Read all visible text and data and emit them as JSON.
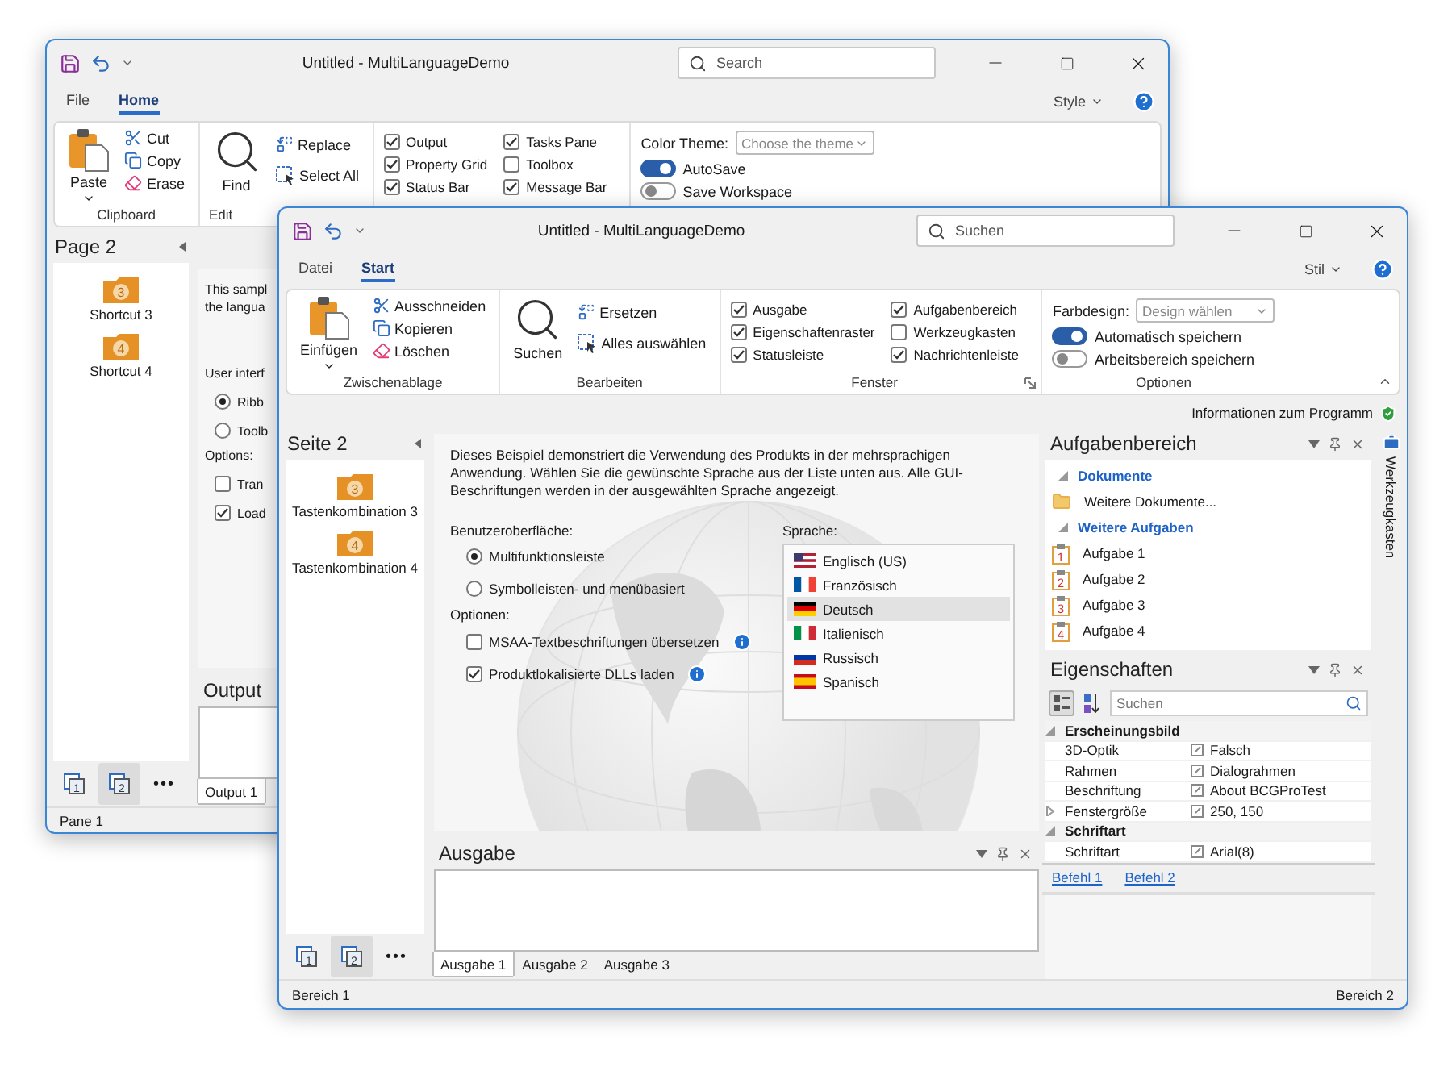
{
  "back_window": {
    "title": "Untitled - MultiLanguageDemo",
    "search": {
      "placeholder": "Search"
    },
    "tabs": [
      {
        "label": "File",
        "selected": false
      },
      {
        "label": "Home",
        "selected": true
      }
    ],
    "style_menu": "Style",
    "ribbon": {
      "clipboard": {
        "paste": "Paste",
        "cut": "Cut",
        "copy": "Copy",
        "erase": "Erase",
        "label": "Clipboard"
      },
      "edit": {
        "find": "Find",
        "replace": "Replace",
        "select_all": "Select All",
        "label": "Edit"
      },
      "view": {
        "checks": [
          {
            "label": "Output",
            "checked": true
          },
          {
            "label": "Property Grid",
            "checked": true
          },
          {
            "label": "Status Bar",
            "checked": true
          },
          {
            "label": "Tasks Pane",
            "checked": true
          },
          {
            "label": "Toolbox",
            "checked": false
          },
          {
            "label": "Message Bar",
            "checked": true
          }
        ]
      },
      "options": {
        "theme_label": "Color Theme:",
        "theme_placeholder": "Choose the theme",
        "toggles": [
          {
            "label": "AutoSave",
            "on": true
          },
          {
            "label": "Save Workspace",
            "on": false
          }
        ]
      }
    },
    "pane": {
      "title": "Page 2",
      "shortcuts": [
        {
          "number": "3",
          "label": "Shortcut 3"
        },
        {
          "number": "4",
          "label": "Shortcut 4"
        }
      ],
      "nav_buttons": [
        {
          "number": "1",
          "selected": false
        },
        {
          "number": "2",
          "selected": true
        }
      ],
      "more": "•••"
    },
    "content": {
      "description": [
        "This sampl",
        "the langua"
      ],
      "ui_label": "User interf",
      "radios": [
        {
          "label": "Ribb",
          "selected": true
        },
        {
          "label": "Toolb",
          "selected": false
        }
      ],
      "options_label": "Options:",
      "checks": [
        {
          "label": "Tran",
          "checked": false
        },
        {
          "label": "Load",
          "checked": true
        }
      ]
    },
    "output": {
      "title": "Output",
      "tabs": [
        {
          "label": "Output 1",
          "selected": true
        }
      ]
    },
    "status": "Pane 1"
  },
  "front_window": {
    "title": "Untitled - MultiLanguageDemo",
    "search": {
      "placeholder": "Suchen"
    },
    "tabs": [
      {
        "label": "Datei",
        "selected": false
      },
      {
        "label": "Start",
        "selected": true
      }
    ],
    "style_menu": "Stil",
    "ribbon": {
      "clipboard": {
        "paste": "Einfügen",
        "cut": "Ausschneiden",
        "copy": "Kopieren",
        "erase": "Löschen",
        "label": "Zwischenablage"
      },
      "edit": {
        "find": "Suchen",
        "replace": "Ersetzen",
        "select_all": "Alles auswählen",
        "label": "Bearbeiten"
      },
      "view": {
        "label": "Fenster",
        "checks": [
          {
            "label": "Ausgabe",
            "checked": true
          },
          {
            "label": "Eigenschaftenraster",
            "checked": true
          },
          {
            "label": "Statusleiste",
            "checked": true
          },
          {
            "label": "Aufgabenbereich",
            "checked": true
          },
          {
            "label": "Werkzeugkasten",
            "checked": false
          },
          {
            "label": "Nachrichtenleiste",
            "checked": true
          }
        ]
      },
      "options": {
        "label": "Optionen",
        "theme_label": "Farbdesign:",
        "theme_placeholder": "Design wählen",
        "toggles": [
          {
            "label": "Automatisch speichern",
            "on": true
          },
          {
            "label": "Arbeitsbereich speichern",
            "on": false
          }
        ]
      }
    },
    "info_link": "Informationen zum Programm",
    "pane": {
      "title": "Seite 2",
      "shortcuts": [
        {
          "number": "3",
          "label": "Tastenkombination 3"
        },
        {
          "number": "4",
          "label": "Tastenkombination 4"
        }
      ],
      "nav_buttons": [
        {
          "number": "1",
          "selected": false
        },
        {
          "number": "2",
          "selected": true
        }
      ],
      "more": "•••"
    },
    "content": {
      "description": "Dieses Beispiel demonstriert die Verwendung des Produkts in der mehrsprachigen Anwendung. Wählen Sie die gewünschte Sprache aus der Liste unten aus. Alle GUI-Beschriftungen werden in der ausgewählten Sprache angezeigt.",
      "ui_label": "Benutzeroberfläche:",
      "radios": [
        {
          "label": "Multifunktionsleiste",
          "selected": true
        },
        {
          "label": "Symbolleisten- und menübasiert",
          "selected": false
        }
      ],
      "options_label": "Optionen:",
      "checks": [
        {
          "label": "MSAA-Textbeschriftungen übersetzen",
          "checked": false
        },
        {
          "label": "Produktlokalisierte DLLs laden",
          "checked": true
        }
      ],
      "language_label": "Sprache:",
      "languages": [
        {
          "label": "Englisch (US)",
          "selected": false
        },
        {
          "label": "Französisch",
          "selected": false
        },
        {
          "label": "Deutsch",
          "selected": true
        },
        {
          "label": "Italienisch",
          "selected": false
        },
        {
          "label": "Russisch",
          "selected": false
        },
        {
          "label": "Spanisch",
          "selected": false
        }
      ]
    },
    "output": {
      "title": "Ausgabe",
      "tabs": [
        {
          "label": "Ausgabe 1",
          "selected": true
        },
        {
          "label": "Ausgabe 2",
          "selected": false
        },
        {
          "label": "Ausgabe 3",
          "selected": false
        }
      ]
    },
    "tasks": {
      "title": "Aufgabenbereich",
      "groups": [
        {
          "title": "Dokumente",
          "expanded": true,
          "items": [
            {
              "kind": "folder",
              "label": "Weitere Dokumente..."
            }
          ]
        },
        {
          "title": "Weitere Aufgaben",
          "expanded": true,
          "items": [
            {
              "kind": "task",
              "number": "1",
              "label": "Aufgabe 1"
            },
            {
              "kind": "task",
              "number": "2",
              "label": "Aufgabe 2"
            },
            {
              "kind": "task",
              "number": "3",
              "label": "Aufgabe 3"
            },
            {
              "kind": "task",
              "number": "4",
              "label": "Aufgabe 4"
            }
          ]
        }
      ]
    },
    "properties": {
      "title": "Eigenschaften",
      "search": {
        "placeholder": "Suchen"
      },
      "categories": [
        {
          "name": "Erscheinungsbild",
          "expanded": true,
          "children": [
            {
              "name": "3D-Optik",
              "value": "Falsch"
            },
            {
              "name": "Rahmen",
              "value": "Dialograhmen"
            },
            {
              "name": "Beschriftung",
              "value": "About BCGProTest"
            },
            {
              "name": "Fenstergröße",
              "value": "250, 150",
              "expanded": false
            }
          ]
        },
        {
          "name": "Schriftart",
          "expanded": true,
          "children": [
            {
              "name": "Schriftart",
              "value": "Arial(8)"
            }
          ]
        }
      ]
    },
    "commands": [
      "Befehl 1",
      "Befehl 2"
    ],
    "side_tab": "Werkzeugkasten",
    "status": {
      "left": "Bereich 1",
      "right": "Bereich 2"
    }
  }
}
